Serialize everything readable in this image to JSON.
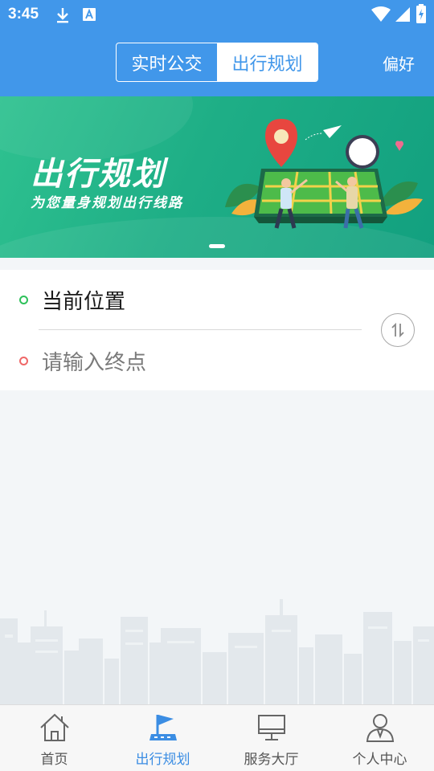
{
  "status_bar": {
    "time": "3:45"
  },
  "header": {
    "tabs": [
      {
        "label": "实时公交",
        "active": false
      },
      {
        "label": "出行规划",
        "active": true
      }
    ],
    "preference_label": "偏好"
  },
  "banner": {
    "title": "出行规划",
    "subtitle": "为您量身规划出行线路"
  },
  "route": {
    "origin_text": "当前位置",
    "destination_placeholder": "请输入终点"
  },
  "bottom_nav": [
    {
      "label": "首页",
      "icon": "home-icon",
      "active": false
    },
    {
      "label": "出行规划",
      "icon": "flag-icon",
      "active": true
    },
    {
      "label": "服务大厅",
      "icon": "monitor-icon",
      "active": false
    },
    {
      "label": "个人中心",
      "icon": "user-icon",
      "active": false
    }
  ],
  "colors": {
    "primary": "#4197ea",
    "banner_green": "#1eae86",
    "origin_dot": "#2ec15a",
    "destination_dot": "#ef6767",
    "nav_active": "#3b8de3"
  }
}
